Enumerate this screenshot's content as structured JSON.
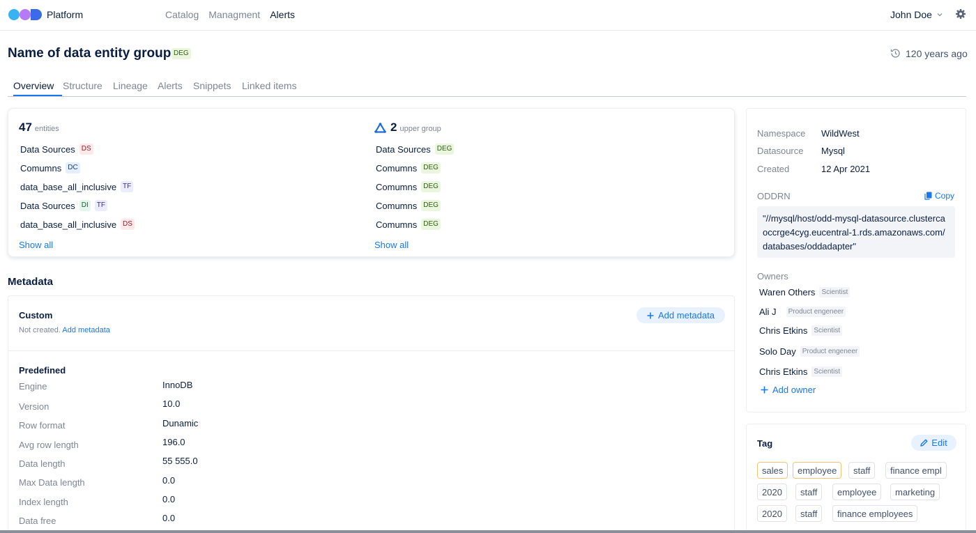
{
  "nav": {
    "brand": "Platform",
    "items": [
      {
        "label": "Catalog"
      },
      {
        "label": "Managment"
      },
      {
        "label": "Alerts"
      }
    ],
    "user": "John Doe",
    "colors": {
      "logo": [
        "#36b3f0",
        "#b77af6",
        "#3d6ae9"
      ],
      "accent": "#1778f2"
    }
  },
  "header": {
    "title": "Name of data entity group",
    "type_badge": "DEG",
    "updated": "120 years ago"
  },
  "tabs": [
    "Overview",
    "Structure",
    "Lineage",
    "Alerts",
    "Snippets",
    "Linked items"
  ],
  "entities": {
    "count": "47",
    "count_label": "entities",
    "items": [
      {
        "name": "Data Sources",
        "badges": [
          "DS"
        ]
      },
      {
        "name": "Comumns",
        "badges": [
          "DC"
        ]
      },
      {
        "name": "data_base_all_inclusive",
        "badges": [
          "TF"
        ]
      },
      {
        "name": "Data Sources",
        "badges": [
          "DI",
          "TF"
        ]
      },
      {
        "name": "data_base_all_inclusive",
        "badges": [
          "DS"
        ]
      }
    ],
    "show_all": "Show all"
  },
  "upper_group": {
    "count": "2",
    "count_label": "upper group",
    "items": [
      {
        "name": "Data Sources",
        "badge": "DEG"
      },
      {
        "name": "Comumns",
        "badge": "DEG"
      },
      {
        "name": "Comumns",
        "badge": "DEG"
      },
      {
        "name": "Comumns",
        "badge": "DEG"
      },
      {
        "name": "Comumns",
        "badge": "DEG"
      }
    ],
    "show_all": "Show all"
  },
  "metadata": {
    "title": "Metadata",
    "custom_title": "Custom",
    "not_created": "Not created.",
    "add_metadata_link": "Add metadata",
    "add_metadata_button": "Add metadata",
    "predefined_title": "Predefined",
    "predefined": [
      {
        "label": "Engine",
        "value": "InnoDB"
      },
      {
        "label": "Version",
        "value": "10.0"
      },
      {
        "label": "Row format",
        "value": "Dunamic"
      },
      {
        "label": "Avg row length",
        "value": "196.0"
      },
      {
        "label": "Data length",
        "value": "55 555.0"
      },
      {
        "label": "Max Data length",
        "value": "0.0"
      },
      {
        "label": "Index length",
        "value": "0.0"
      },
      {
        "label": "Data free",
        "value": "0.0"
      }
    ]
  },
  "info": {
    "namespace_label": "Namespace",
    "namespace": "WildWest",
    "datasource_label": "Datasource",
    "datasource": "Mysql",
    "created_label": "Created",
    "created": "12 Apr 2021",
    "oddrn_label": "ODDRN",
    "copy": "Copy",
    "oddrn": "\"//mysql/host/odd-mysql-datasource.clusterca occrge4cyg.eucentral-1.rds.amazonaws.com/databases/oddadapter\"",
    "owners_label": "Owners",
    "owners": [
      {
        "name": "Waren Others",
        "role": "Scientist"
      },
      {
        "name": "Ali J",
        "role": "Product engeneer"
      },
      {
        "name": "Chris Etkins",
        "role": "Scientist"
      },
      {
        "name": "Solo Day",
        "role": "Product engeneer"
      },
      {
        "name": "Chris Etkins",
        "role": "Scientist"
      }
    ],
    "add_owner": "Add owner"
  },
  "tags": {
    "title": "Tag",
    "edit": "Edit",
    "items": [
      {
        "label": "sales",
        "important": true
      },
      {
        "label": "employee",
        "important": true
      },
      {
        "label": "staff",
        "important": false
      },
      {
        "label": "finance empl",
        "important": false
      },
      {
        "label": "2020",
        "important": false
      },
      {
        "label": "staff",
        "important": false
      },
      {
        "label": "employee",
        "important": false
      },
      {
        "label": "marketing",
        "important": false
      },
      {
        "label": "2020",
        "important": false
      },
      {
        "label": "staff",
        "important": false
      },
      {
        "label": "finance employees",
        "important": false
      }
    ]
  }
}
